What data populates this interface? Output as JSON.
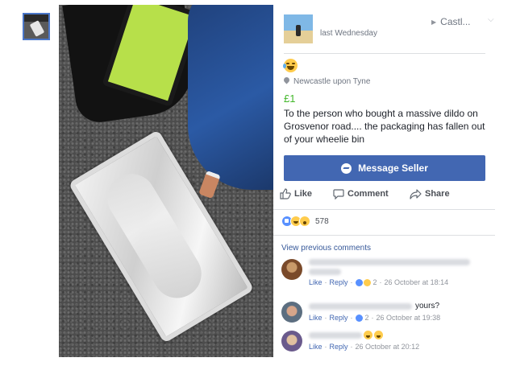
{
  "post": {
    "time": "last Wednesday",
    "location_short": "Castl...",
    "place": "Newcastle upon Tyne",
    "price": "£1",
    "description": "To the person who bought a massive dildo on Grosvenor road.... the packaging has fallen out of your wheelie bin"
  },
  "buttons": {
    "message_seller": "Message Seller"
  },
  "actions": {
    "like": "Like",
    "comment": "Comment",
    "share": "Share"
  },
  "reactions": {
    "count": "578"
  },
  "comments_section": {
    "view_previous": "View previous comments"
  },
  "comments": [
    {
      "visible_text": "",
      "like": "Like",
      "reply": "Reply",
      "reaction_count": "2",
      "timestamp": "26 October at 18:14"
    },
    {
      "visible_text": "yours?",
      "like": "Like",
      "reply": "Reply",
      "reaction_count": "2",
      "timestamp": "26 October at 19:38"
    },
    {
      "visible_text": "",
      "like": "Like",
      "reply": "Reply",
      "reaction_count": "",
      "timestamp": "26 October at 20:12"
    }
  ],
  "colors": {
    "brand_blue": "#4267b2",
    "price_green": "#42b72a",
    "link_blue": "#365899"
  },
  "icons": [
    "chevron-down-icon",
    "location-pin-icon",
    "messenger-icon",
    "thumbs-up-icon",
    "comment-bubble-icon",
    "share-arrow-icon"
  ]
}
